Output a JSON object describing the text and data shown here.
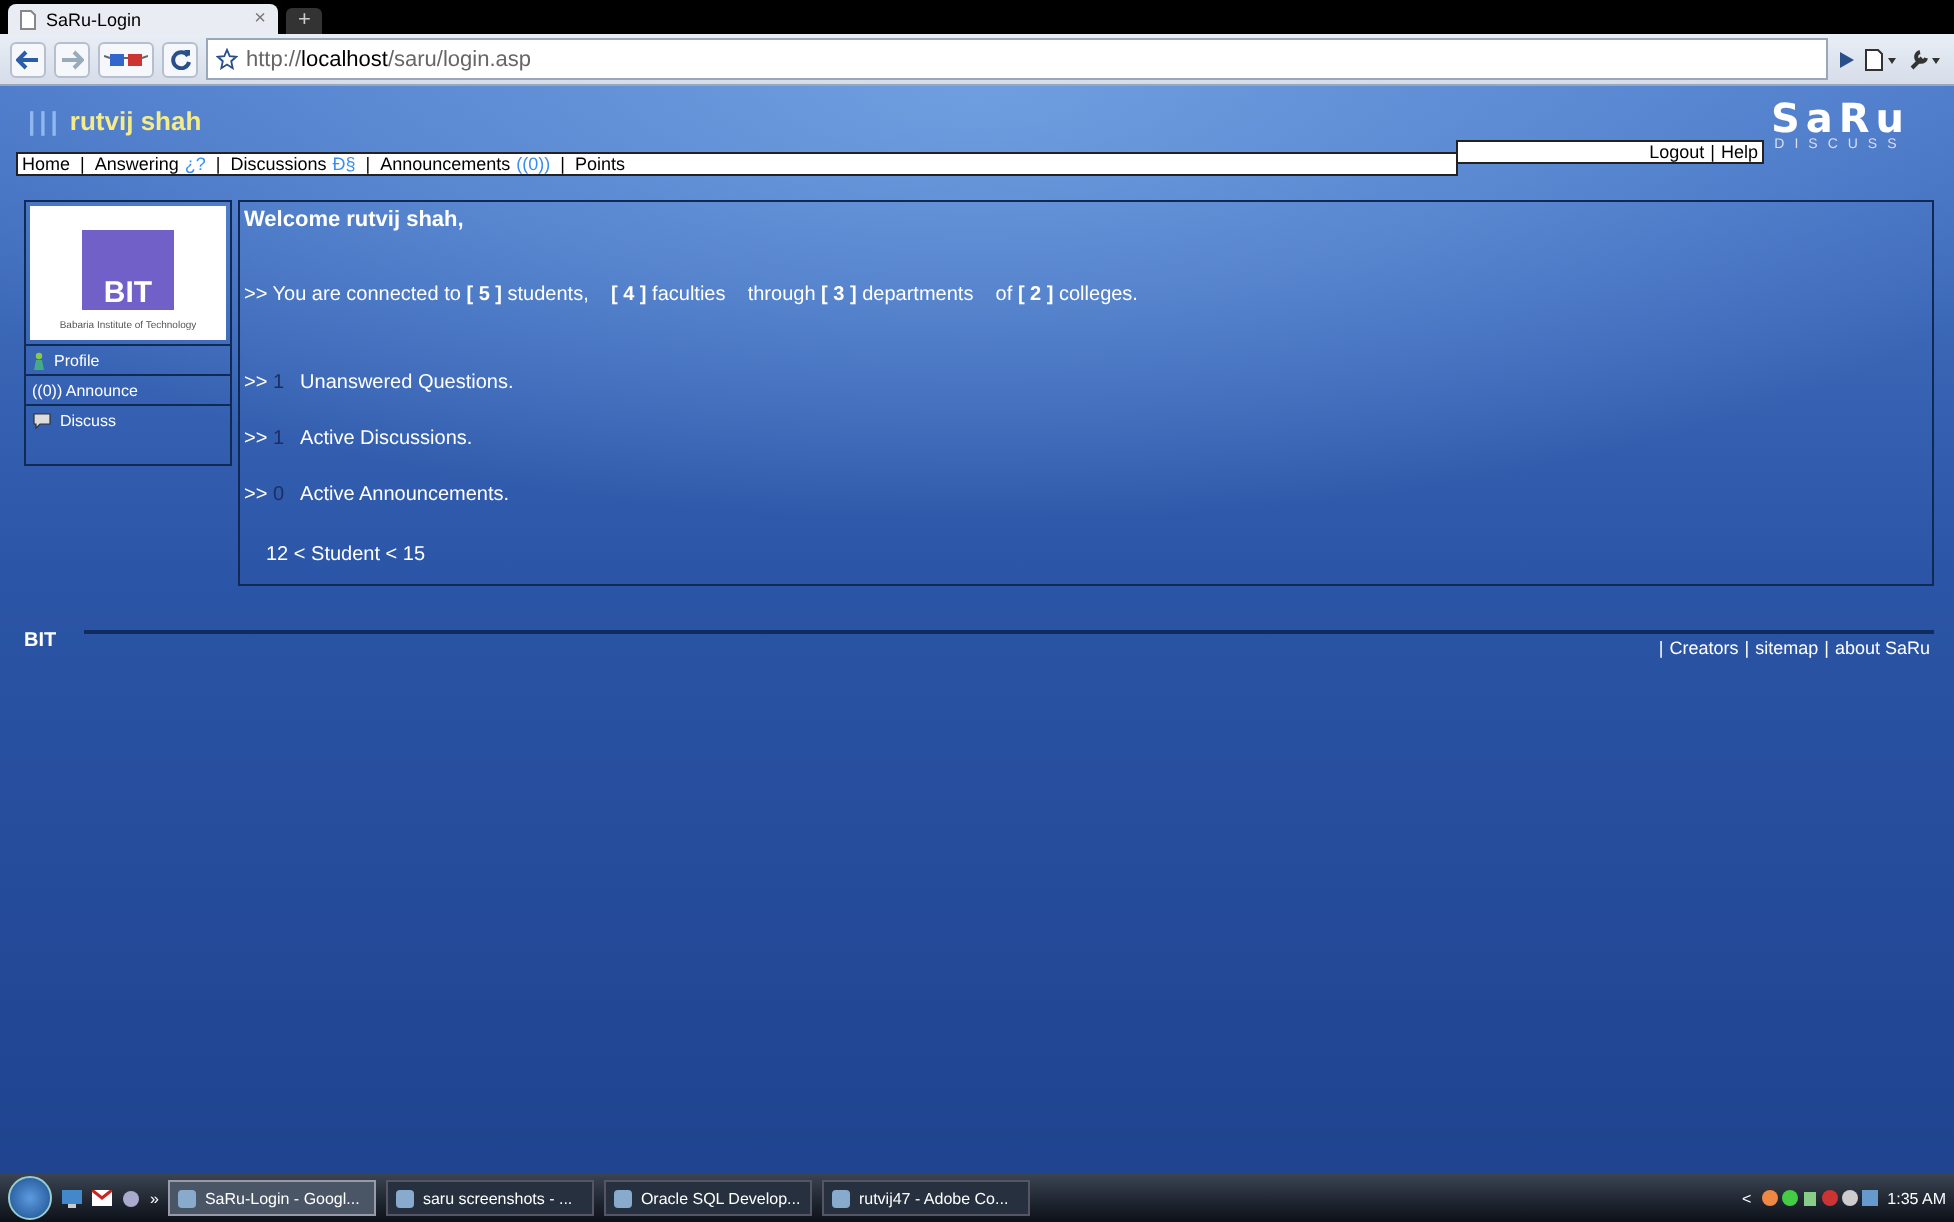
{
  "browser": {
    "tabs": [
      {
        "title": "SaRu-Login",
        "close": "×",
        "selected": true
      }
    ],
    "new_tab": "+",
    "url_scheme": "http://",
    "url_host": "localhost",
    "url_path": "/saru/login.asp"
  },
  "header": {
    "bars": "|||",
    "user": "rutvij shah",
    "logo_title": "SaRu",
    "logo_subtitle": "DISCUSS",
    "account_links": [
      "Logout",
      "Help"
    ],
    "account_separator": "|"
  },
  "nav": {
    "separator": "|",
    "items": [
      {
        "label": "Home"
      },
      {
        "label": "Answering",
        "badge": "¿?"
      },
      {
        "label": "Discussions",
        "badge": "Ð§"
      },
      {
        "label": "Announcements",
        "badge": "((0))"
      },
      {
        "label": "Points"
      }
    ]
  },
  "sidebar": {
    "logo_text": "BIT",
    "logo_caption": "Babaria Institute of Technology",
    "items": [
      {
        "label": "Profile"
      },
      {
        "label": "((0)) Announce"
      },
      {
        "label": "Discuss"
      }
    ]
  },
  "main": {
    "welcome": "Welcome rutvij shah,",
    "connected": ">> You are connected to **[ 5 ]** students,    **[ 4 ]** faculties    through **[ 3 ]** departments    of **[ 2 ]** colleges.",
    "stats": [
      {
        "prefix": ">>",
        "count": "1",
        "label": "Unanswered Questions."
      },
      {
        "prefix": ">>",
        "count": "1",
        "label": "Active Discussions."
      },
      {
        "prefix": ">>",
        "count": "0",
        "label": "Active Announcements."
      }
    ],
    "range": "12 < Student < 15"
  },
  "footer": {
    "brand": "BIT",
    "separator": "|",
    "links": [
      "Creators",
      "sitemap",
      "about SaRu"
    ]
  },
  "taskbar": {
    "overflow": "»",
    "tasks": [
      {
        "label": "SaRu-Login - Googl...",
        "selected": true
      },
      {
        "label": "saru screenshots - ...",
        "selected": false
      },
      {
        "label": "Oracle SQL Develop...",
        "selected": false
      },
      {
        "label": "rutvij47 - Adobe Co...",
        "selected": false
      }
    ],
    "tray_arrow": "<",
    "time": "1:35 AM"
  }
}
